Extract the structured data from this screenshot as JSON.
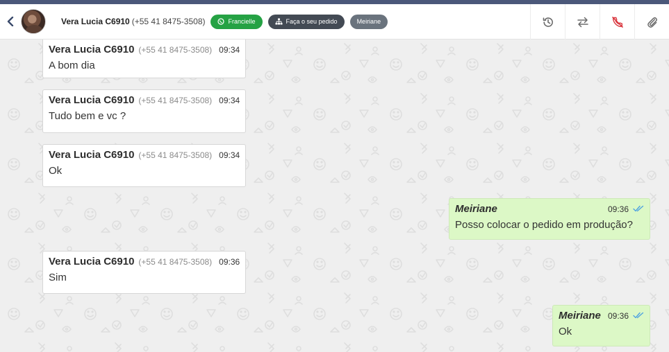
{
  "header": {
    "contact_name": "Vera Lucia C6910",
    "contact_phone": "(+55 41 8475-3508)",
    "tags": [
      {
        "label": "Francielle",
        "color": "#25a244",
        "icon": "whatsapp-icon"
      },
      {
        "label": "Faça o seu pedido",
        "color": "#434a54",
        "icon": "org-chart-icon"
      },
      {
        "label": "Meiriane",
        "color": "#6a737d"
      }
    ],
    "actions": [
      "history-icon",
      "transfer-icon",
      "end-call-icon",
      "attach-icon"
    ]
  },
  "messages": [
    {
      "direction": "in",
      "sender": "Vera Lucia C6910",
      "phone": "(+55 41 8475-3508)",
      "time": "09:34",
      "text": "A bom dia"
    },
    {
      "direction": "in",
      "sender": "Vera Lucia C6910",
      "phone": "(+55 41 8475-3508)",
      "time": "09:34",
      "text": "Tudo bem e vc ?"
    },
    {
      "direction": "in",
      "sender": "Vera Lucia C6910",
      "phone": "(+55 41 8475-3508)",
      "time": "09:34",
      "text": "Ok"
    },
    {
      "direction": "out",
      "sender": "Meiriane",
      "time": "09:36",
      "text": "Posso colocar o pedido em produção?",
      "status": "read"
    },
    {
      "direction": "in",
      "sender": "Vera Lucia C6910",
      "phone": "(+55 41 8475-3508)",
      "time": "09:36",
      "text": "Sim"
    },
    {
      "direction": "out",
      "sender": "Meiriane",
      "time": "09:36",
      "text": "Ok",
      "status": "read"
    }
  ],
  "colors": {
    "read_check": "#4fa3e0",
    "end_call": "#d9363e"
  }
}
